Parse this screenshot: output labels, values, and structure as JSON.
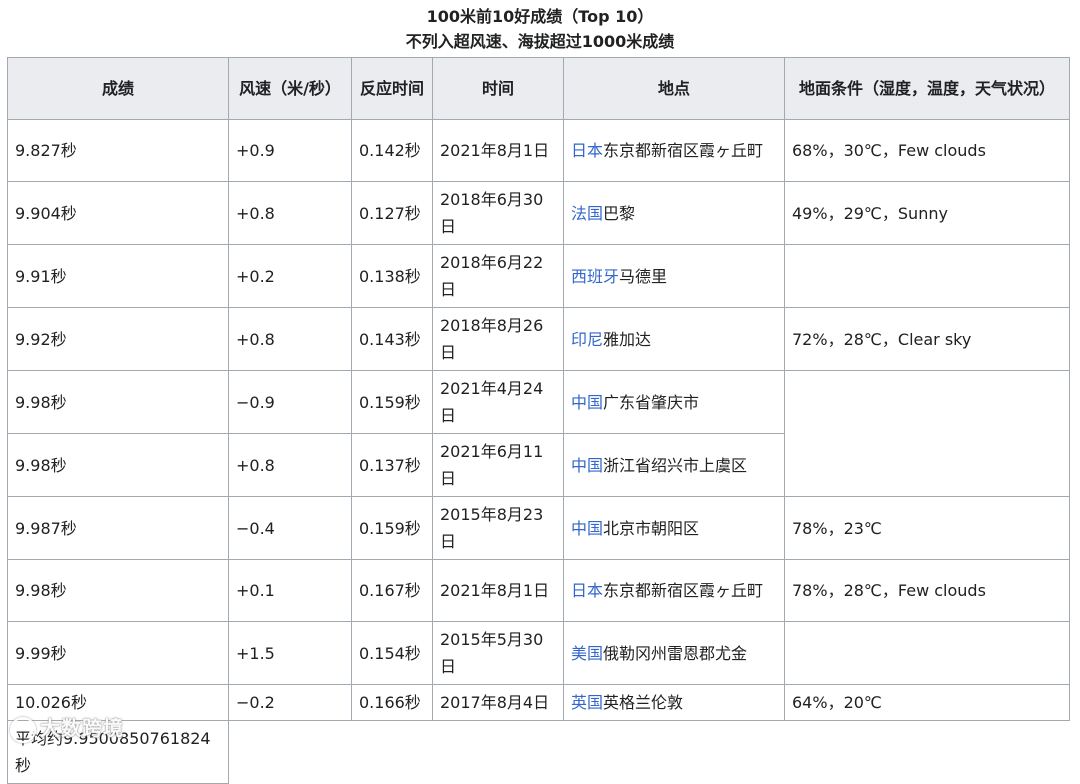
{
  "caption": {
    "line1": "100米前10好成绩（Top 10）",
    "line2": "不列入超风速、海拔超过1000米成绩"
  },
  "headers": {
    "score": "成绩",
    "wind": "风速（米/秒）",
    "reaction": "反应时间",
    "date": "时间",
    "location": "地点",
    "conditions": "地面条件（湿度，温度，天气状况）"
  },
  "rows": [
    {
      "score": "9.827秒",
      "wind": "+0.9",
      "reaction": "0.142秒",
      "date": "2021年8月1日",
      "country": "日本",
      "place": "东京都新宿区霞ヶ丘町",
      "conditions": "68%，30℃，Few clouds"
    },
    {
      "score": "9.904秒",
      "wind": "+0.8",
      "reaction": "0.127秒",
      "date": "2018年6月30日",
      "country": "法国",
      "place": "巴黎",
      "conditions": "49%，29℃，Sunny"
    },
    {
      "score": "9.91秒",
      "wind": "+0.2",
      "reaction": "0.138秒",
      "date": "2018年6月22日",
      "country": "西班牙",
      "place": "马德里",
      "conditions": ""
    },
    {
      "score": "9.92秒",
      "wind": "+0.8",
      "reaction": "0.143秒",
      "date": "2018年8月26日",
      "country": "印尼",
      "place": "雅加达",
      "conditions": "72%，28℃，Clear sky"
    },
    {
      "score": "9.98秒",
      "wind": "−0.9",
      "reaction": "0.159秒",
      "date": "2021年4月24日",
      "country": "中国",
      "place": "广东省肇庆市",
      "conditions": ""
    },
    {
      "score": "9.98秒",
      "wind": "+0.8",
      "reaction": "0.137秒",
      "date": "2021年6月11日",
      "country": "中国",
      "place": "浙江省绍兴市上虞区"
    },
    {
      "score": "9.987秒",
      "wind": "−0.4",
      "reaction": "0.159秒",
      "date": "2015年8月23日",
      "country": "中国",
      "place": "北京市朝阳区",
      "conditions": "78%，23℃"
    },
    {
      "score": "9.98秒",
      "wind": "+0.1",
      "reaction": "0.167秒",
      "date": "2021年8月1日",
      "country": "日本",
      "place": "东京都新宿区霞ヶ丘町",
      "conditions": "78%，28℃，Few clouds"
    },
    {
      "score": "9.99秒",
      "wind": "+1.5",
      "reaction": "0.154秒",
      "date": "2015年5月30日",
      "country": "美国",
      "place": "俄勒冈州雷恩郡尤金",
      "conditions": ""
    },
    {
      "score": "10.026秒",
      "wind": "−0.2",
      "reaction": "0.166秒",
      "date": "2017年8月4日",
      "country": "英国",
      "place": "英格兰伦敦",
      "conditions": "64%，20℃"
    }
  ],
  "average": "平均约9.9500850761824秒",
  "watermark": "大数跨境"
}
